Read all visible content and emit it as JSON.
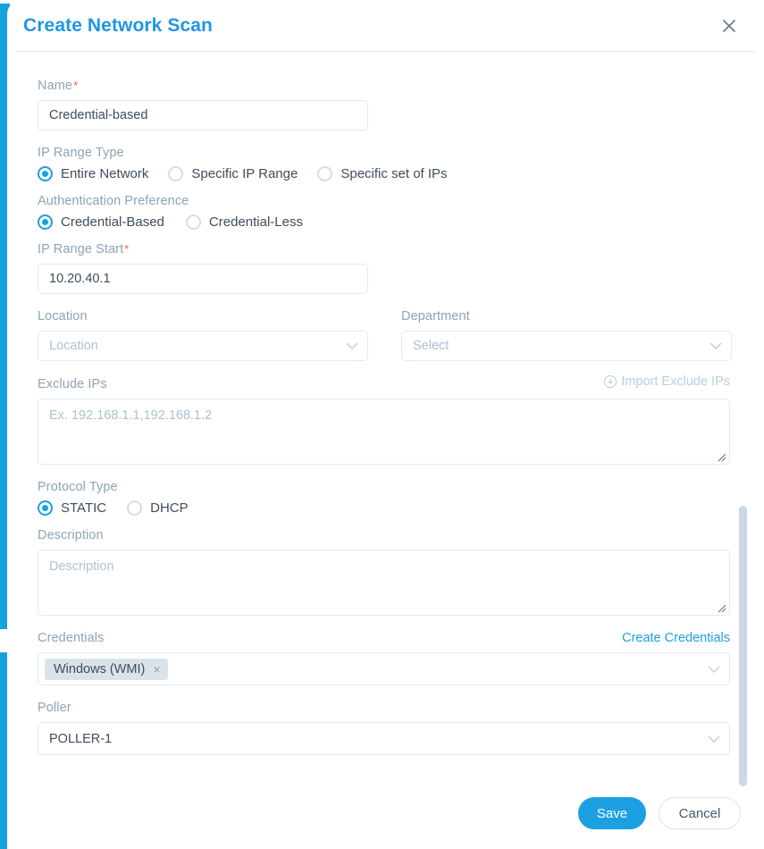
{
  "dialog": {
    "title": "Create Network Scan",
    "close_icon": "close-x-icon"
  },
  "fields": {
    "name": {
      "label": "Name",
      "required": "*",
      "value": "Credential-based"
    },
    "ip_range_type": {
      "label": "IP Range Type",
      "options": [
        {
          "label": "Entire Network",
          "selected": true
        },
        {
          "label": "Specific IP Range",
          "selected": false
        },
        {
          "label": "Specific set of IPs",
          "selected": false
        }
      ]
    },
    "authentication_preference": {
      "label": "Authentication Preference",
      "options": [
        {
          "label": "Credential-Based",
          "selected": true
        },
        {
          "label": "Credential-Less",
          "selected": false
        }
      ]
    },
    "ip_range_start": {
      "label": "IP Range Start",
      "required": "*",
      "value": "10.20.40.1"
    },
    "location": {
      "label": "Location",
      "placeholder": "Location"
    },
    "department": {
      "label": "Department",
      "placeholder": "Select"
    },
    "exclude_ips": {
      "label": "Exclude IPs",
      "placeholder": "Ex. 192.168.1.1,192.168.1.2",
      "import_link": "Import Exclude IPs"
    },
    "protocol_type": {
      "label": "Protocol Type",
      "options": [
        {
          "label": "STATIC",
          "selected": true
        },
        {
          "label": "DHCP",
          "selected": false
        }
      ]
    },
    "description": {
      "label": "Description",
      "placeholder": "Description"
    },
    "credentials": {
      "label": "Credentials",
      "create_link": "Create Credentials",
      "chips": [
        {
          "label": "Windows (WMI)",
          "remove": "×"
        }
      ]
    },
    "poller": {
      "label": "Poller",
      "value": "POLLER-1"
    }
  },
  "footer": {
    "save_label": "Save",
    "cancel_label": "Cancel"
  },
  "colors": {
    "accent": "#1ba1e2",
    "title": "#2196e3",
    "required": "#ef5b4c",
    "label": "#8fa3b5",
    "text": "#3f4c5c",
    "border": "#e3e9ef",
    "chip_bg": "#dbe3ea",
    "scrollbar": "#ccd8e3"
  }
}
